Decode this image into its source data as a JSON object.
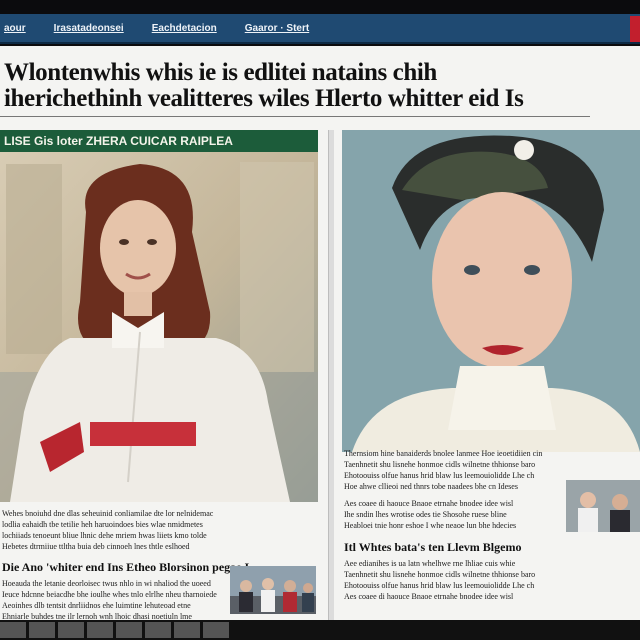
{
  "nav": {
    "items": [
      "aour",
      "Irasatadeonsei",
      "Eachdetacion",
      "Gaaror · Stert"
    ],
    "accent_color": "#c21f2d",
    "bar_color": "#1f4a72"
  },
  "headline": {
    "line1": "Wlontenwhis whis ie is edlitei natains chih",
    "line2": "iherichethinh vealitteres wiles Hlerto whitter eid Is"
  },
  "left_article": {
    "caption": "LISE Gis loter ZHERA CUICAR RAIPLEA",
    "caption_color": "#1c5c3a",
    "photo_icon": "portrait-photo-icon",
    "lines_top": [
      "Wehes bnoiuhd dne dlas seheuinid conliamilae dte lor nelnidemac",
      "lodlia eahaidh tbe tetilie heh haruoindoes bies wlae nmidmetes",
      "lochiiads tenoeunt bliue lhnic dehe mriem hwas liiets kmo tolde",
      "Hebetes dtrmiiue ttltha buia deb cinnoeh lnes thtle eslhoed"
    ],
    "subhead": "Die Ano 'whiter end Ins Etheo Blorsinon pegae I",
    "lines_bottom": [
      "Hoeauda the letanie deorloisec twus nhlo in wi nhaliod the uoeed",
      "Ieuce hdcnne beiacdhe bhe ioulhe whes tnlo elrlhe nheu tharnoiede",
      "Aeoinhes dlb tentsit dnrliidnos ehe luimtine lehuteoad etne",
      "Ehniarle buhdes tne ilr lernoh wnh lhoic dhasi noetiuln lme"
    ],
    "thumb_icon": "crowd-photo-icon"
  },
  "right_article": {
    "photo_icon": "portrait-photo-icon",
    "lines_top": [
      "Thernsiom hine banaiderds bnolee lanmee Hoe ieoetidiien cin",
      "Taenhnetit shu lisnehe honmoe cidls wilnetne thhionse baro",
      "Ehotoouiss olfue hanus hrid blaw lus leemouiolidde Lhe ch",
      "Hoe ahwe cllieoi ned thnrs tobe naadees bhe cn Ideses"
    ],
    "subhead": "Itl Whtes bata's ten Llevm Blgemo",
    "lines_bottom": [
      "Aes coaee di haouce Bnaoe etrnahe bnodee idee wisl",
      "Ihe sndin lhes wrotise odes tie Shosohe ruese bline",
      "Heabloei tnie honr eshoe I whe neaoe lun bhe hdecies",
      "Aee edianihes is ua latn whelhwe rne lhliae cuis whie"
    ],
    "thumb_icon": "people-photo-icon"
  }
}
